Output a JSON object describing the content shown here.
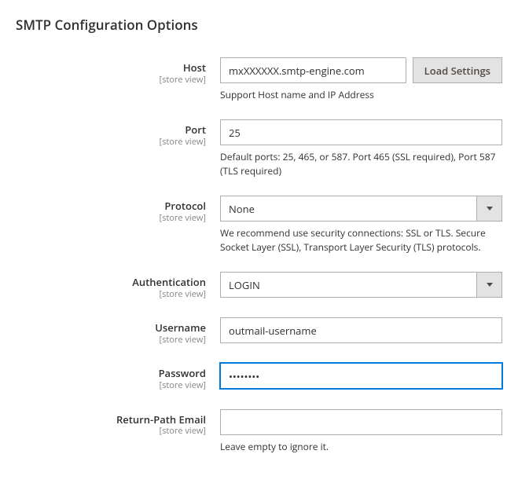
{
  "section": {
    "title": "SMTP Configuration Options"
  },
  "fields": {
    "host": {
      "label": "Host",
      "scope": "[store view]",
      "value": "mxXXXXXX.smtp-engine.com",
      "button": "Load Settings",
      "note": "Support Host name and IP Address"
    },
    "port": {
      "label": "Port",
      "scope": "[store view]",
      "value": "25",
      "note": "Default ports: 25, 465, or 587. Port 465 (SSL required), Port 587 (TLS required)"
    },
    "protocol": {
      "label": "Protocol",
      "scope": "[store view]",
      "value": "None",
      "note": "We recommend use security connections: SSL or TLS. Secure Socket Layer (SSL), Transport Layer Security (TLS) protocols."
    },
    "authentication": {
      "label": "Authentication",
      "scope": "[store view]",
      "value": "LOGIN"
    },
    "username": {
      "label": "Username",
      "scope": "[store view]",
      "value": "outmail-username"
    },
    "password": {
      "label": "Password",
      "scope": "[store view]",
      "value": "••••••••"
    },
    "return_path": {
      "label": "Return-Path Email",
      "scope": "[store view]",
      "value": "",
      "note": "Leave empty to ignore it."
    }
  }
}
